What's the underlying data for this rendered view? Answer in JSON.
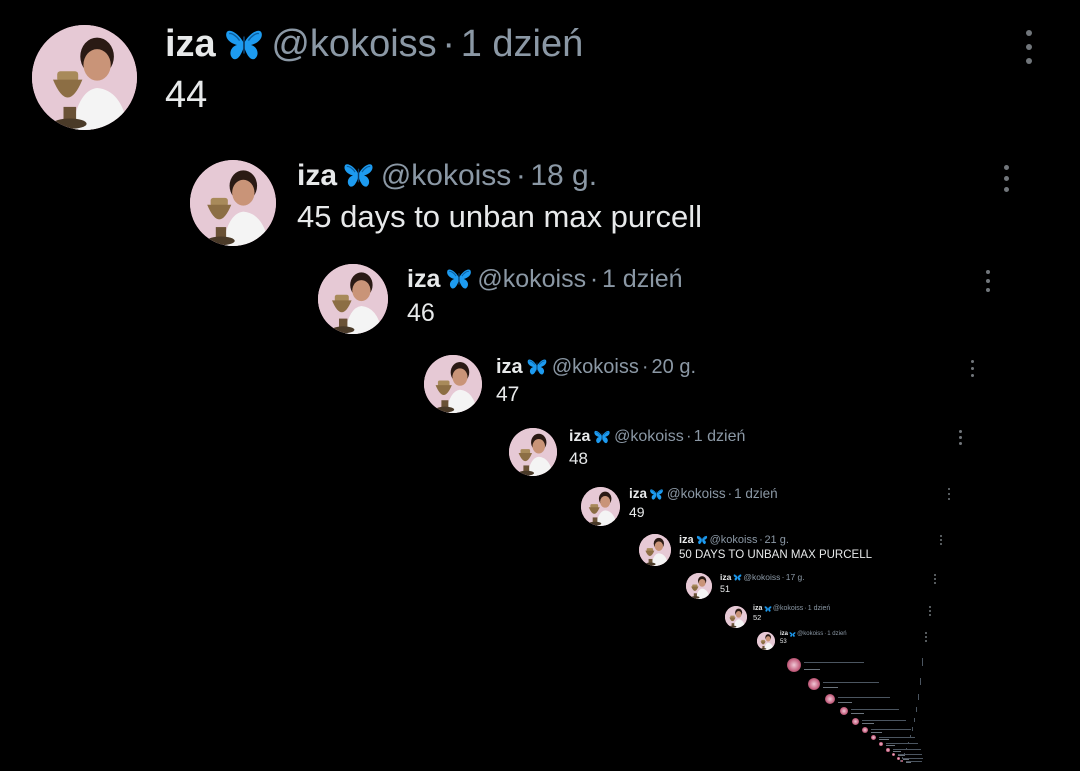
{
  "thread": [
    {
      "name": "iza",
      "handle": "@kokoiss",
      "sep": "·",
      "time": "1 dzień",
      "text": "44"
    },
    {
      "name": "iza",
      "handle": "@kokoiss",
      "sep": "·",
      "time": "18 g.",
      "text": "45 days to unban max purcell"
    },
    {
      "name": "iza",
      "handle": "@kokoiss",
      "sep": "·",
      "time": "1 dzień",
      "text": "46"
    },
    {
      "name": "iza",
      "handle": "@kokoiss",
      "sep": "·",
      "time": "20 g.",
      "text": "47"
    },
    {
      "name": "iza",
      "handle": "@kokoiss",
      "sep": "·",
      "time": "1 dzień",
      "text": "48"
    },
    {
      "name": "iza",
      "handle": "@kokoiss",
      "sep": "·",
      "time": "1 dzień",
      "text": "49"
    },
    {
      "name": "iza",
      "handle": "@kokoiss",
      "sep": "·",
      "time": "21 g.",
      "text": "50 DAYS TO UNBAN MAX PURCELL"
    },
    {
      "name": "iza",
      "handle": "@kokoiss",
      "sep": "·",
      "time": "17 g.",
      "text": "51"
    },
    {
      "name": "iza",
      "handle": "@kokoiss",
      "sep": "·",
      "time": "1 dzień",
      "text": "52"
    },
    {
      "name": "iza",
      "handle": "@kokoiss",
      "sep": "·",
      "time": "1 dzień",
      "text": "53"
    }
  ],
  "colors": {
    "background": "#000000",
    "text": "#e7e9ea",
    "muted": "#8b98a5",
    "butterfly": "#1d9bf0"
  },
  "icons": {
    "verified": "butterfly-icon",
    "menu": "more-options-icon",
    "avatar": "profile-avatar"
  }
}
